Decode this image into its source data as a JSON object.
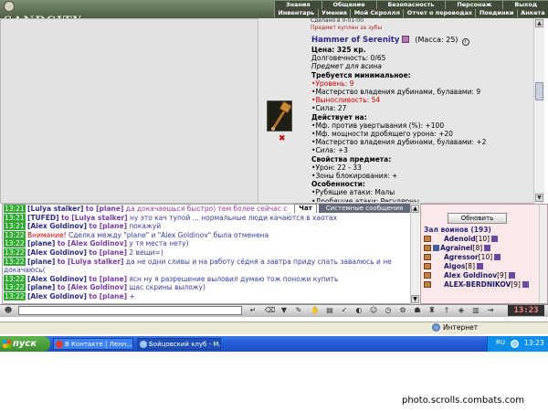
{
  "header": {
    "logo_text": "SANDCITY",
    "menu_top": [
      "Знания",
      "Общение",
      "Безопасность",
      "Персонаж",
      "Выход"
    ],
    "menu_bottom": [
      "Инвентарь",
      "Умения",
      "Мой Скроллл",
      "Отчет о переводах",
      "Поединки",
      "Анкета"
    ]
  },
  "item": {
    "prev_fragment": "Сделано в 0-01-00",
    "prev_note": "Предмет куплен за зубы",
    "name": "Hammer of Serenity",
    "mass": "(Масса: 25)",
    "price": "Цена: 325 кр.",
    "durability": "Долговечность: 0/65",
    "subtitle": "Предмет для всина",
    "req_title": "Требуется минимальное:",
    "req_level": "Уровень: 9",
    "req_mastery": "Мастерство владения дубинами, булавами: 9",
    "req_endurance": "Выносливость: 54",
    "req_strength": "Сила: 27",
    "effects_title": "Действует на:",
    "eff_1": "Мф. против увертывания (%): +100",
    "eff_2": "Мф. мощности дробящего урона: +20",
    "eff_3": "Мастерство владения дубинами, булавами: +2",
    "eff_4": "Сила: +3",
    "props_title": "Свойства предмета:",
    "prop_damage": "Урон: 22 - 33",
    "prop_zones": "Зоны блокирования: +",
    "features_title": "Особенности:",
    "feat_1": "Рубящие атаки: Малы",
    "feat_2": "Дробящие атаки: Регулярны"
  },
  "tabs": {
    "chat": "Чат",
    "system": "Системные сообщения"
  },
  "chat": {
    "lines": [
      {
        "time": "13:21",
        "from": "[Lulya stalker]",
        "to": "to [plane]",
        "text": " да докачаешься быстро) тем более сейчас с"
      },
      {
        "time": "13:21",
        "from": "[TUFED]",
        "to": "to [Lulya stalker]",
        "text": " ну это кач тупой ... нормальные люди качаются в хаотах"
      },
      {
        "time": "13:21",
        "from": "[Alex Goldinov]",
        "to": "to [plane]",
        "text": " покажуй"
      },
      {
        "time": "13:22",
        "warn": "Внимание!",
        "text": " Сделка между \"plane\" и \"Alex Goldinov\" была отменена"
      },
      {
        "time": "13:22",
        "from": "[plane]",
        "to": "to [Alex Goldinov]",
        "text": " у тя места нету)"
      },
      {
        "time": "13:22",
        "from": "[Alex Goldinov]",
        "to": "to [plane]",
        "text": " 2 вещи=)"
      },
      {
        "time": "13:22",
        "from": "[plane]",
        "to": "to [Lulya stalker]",
        "text": " да не одни сливы и на работу сёдня а завтра приду спать завалюсь и не докачаюсь("
      },
      {
        "time": "13:22",
        "from": "[Alex Goldinov]",
        "to": "to [plane]",
        "text": " ясн ну я разрешение выловил думаю тож поножи купить"
      },
      {
        "time": "13:22",
        "from": "[plane]",
        "to": "to [Alex Goldinov]",
        "text": " щас скрины выложу)"
      },
      {
        "time": "13:22",
        "from": "[Alex Goldinov]",
        "to": "to [plane]",
        "text": " +"
      }
    ]
  },
  "users": {
    "refresh_label": "Обновить",
    "title": "Зал воинов (193)",
    "list": [
      {
        "name": "Adenoid",
        "level": "[10]"
      },
      {
        "name": "Agrainel",
        "level": "[8]"
      },
      {
        "name": "Agressor",
        "level": "[10]"
      },
      {
        "name": "Algos",
        "level": "[8]"
      },
      {
        "name": "Alex Goldinov",
        "level": "[9]"
      },
      {
        "name": "ALEX-BERDNIKOV",
        "level": "[9]"
      }
    ]
  },
  "toolbar": {
    "clock": "13:23"
  },
  "browser": {
    "status_zone": "Интернет"
  },
  "taskbar": {
    "start_label": "пуск",
    "task1": "В Контакте | Ленн...",
    "task2": "Бойцовский клуб - М...",
    "lang": "RU",
    "time": "13:23"
  },
  "watermark": "photo.scrolls.combats.com",
  "colors": {
    "accent_green": "#33aa33",
    "red_text": "#d00000",
    "nick_blue": "#2a2a8a",
    "taskbar_blue": "#245edb"
  }
}
